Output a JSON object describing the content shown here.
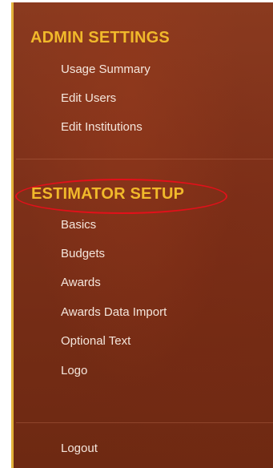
{
  "admin_settings": {
    "title": "ADMIN SETTINGS",
    "items": [
      {
        "label": "Usage Summary"
      },
      {
        "label": "Edit Users"
      },
      {
        "label": "Edit Institutions"
      }
    ]
  },
  "estimator_setup": {
    "title": "ESTIMATOR SETUP",
    "items": [
      {
        "label": "Basics"
      },
      {
        "label": "Budgets"
      },
      {
        "label": "Awards"
      },
      {
        "label": "Awards Data Import"
      },
      {
        "label": "Optional Text"
      },
      {
        "label": "Logo"
      }
    ]
  },
  "footer": {
    "logout_label": "Logout"
  },
  "colors": {
    "section_title": "#f1b92b",
    "nav_text": "#f4e6dc",
    "background": "#7e3019",
    "accent_border": "#e2b23a",
    "annotation": "#e3101a"
  }
}
